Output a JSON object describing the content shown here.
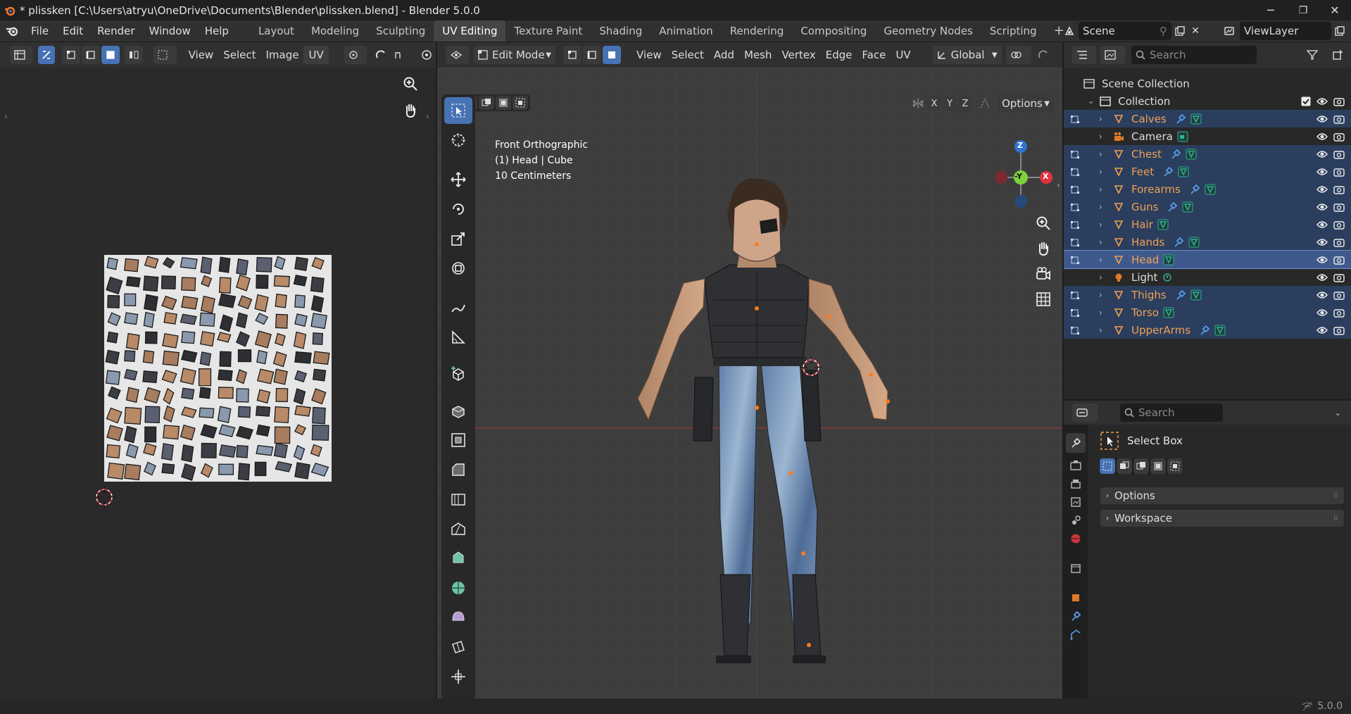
{
  "window": {
    "title": "* plissken [C:\\Users\\atryu\\OneDrive\\Documents\\Blender\\plissken.blend] - Blender 5.0.0",
    "minimize": "─",
    "restore": "❐",
    "close": "✕"
  },
  "menu": [
    "File",
    "Edit",
    "Render",
    "Window",
    "Help"
  ],
  "workspaces": [
    "Layout",
    "Modeling",
    "Sculpting",
    "UV Editing",
    "Texture Paint",
    "Shading",
    "Animation",
    "Rendering",
    "Compositing",
    "Geometry Nodes",
    "Scripting"
  ],
  "active_workspace": "UV Editing",
  "add_tab": "+",
  "scene": {
    "name": "Scene",
    "view_layer": "ViewLayer"
  },
  "uv_editor": {
    "menus": [
      "View",
      "Select",
      "Image",
      "UV"
    ]
  },
  "viewport": {
    "mode": "Edit Mode",
    "menus": [
      "View",
      "Select",
      "Add",
      "Mesh",
      "Vertex",
      "Edge",
      "Face",
      "UV"
    ],
    "transform_orientation": "Global",
    "axis_x": "X",
    "axis_y": "Y",
    "axis_z": "Z",
    "options": "Options",
    "overlay_line1": "Front Orthographic",
    "overlay_line2": "(1) Head | Cube",
    "overlay_line3": "10 Centimeters",
    "gizmo_z": "Z",
    "gizmo_y": "-Y",
    "gizmo_x": "X"
  },
  "outliner": {
    "search_placeholder": "Search",
    "scene_collection": "Scene Collection",
    "collection": "Collection",
    "items": [
      {
        "name": "Calves",
        "type": "mesh",
        "selected": true,
        "modifier": true
      },
      {
        "name": "Camera",
        "type": "camera",
        "selected": false,
        "modifier": false
      },
      {
        "name": "Chest",
        "type": "mesh",
        "selected": true,
        "modifier": true
      },
      {
        "name": "Feet",
        "type": "mesh",
        "selected": true,
        "modifier": true
      },
      {
        "name": "Forearms",
        "type": "mesh",
        "selected": true,
        "modifier": true
      },
      {
        "name": "Guns",
        "type": "mesh",
        "selected": true,
        "modifier": true
      },
      {
        "name": "Hair",
        "type": "mesh",
        "selected": true,
        "modifier": false
      },
      {
        "name": "Hands",
        "type": "mesh",
        "selected": true,
        "modifier": true
      },
      {
        "name": "Head",
        "type": "mesh",
        "selected": true,
        "modifier": false,
        "active": true
      },
      {
        "name": "Light",
        "type": "light",
        "selected": false,
        "modifier": false
      },
      {
        "name": "Thighs",
        "type": "mesh",
        "selected": true,
        "modifier": true
      },
      {
        "name": "Torso",
        "type": "mesh",
        "selected": true,
        "modifier": false
      },
      {
        "name": "UpperArms",
        "type": "mesh",
        "selected": true,
        "modifier": true
      }
    ]
  },
  "properties": {
    "search_placeholder": "Search",
    "tool_name": "Select Box",
    "panels": [
      "Options",
      "Workspace"
    ]
  },
  "statusbar": {
    "version": "5.0.0"
  },
  "colors": {
    "accent": "#4772b3",
    "selected_text": "#f0a155",
    "mesh_icon": "#2fb39a"
  }
}
